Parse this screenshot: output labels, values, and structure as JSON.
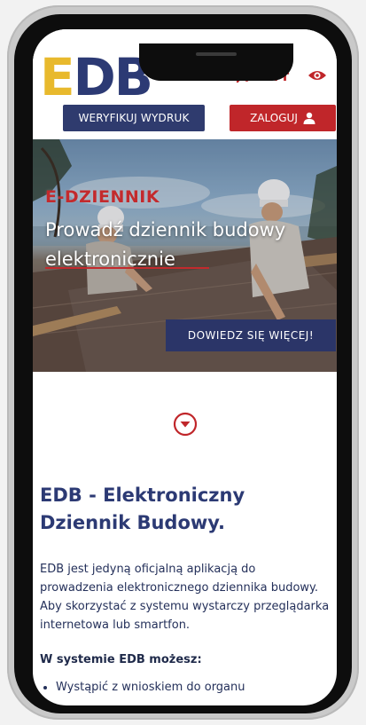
{
  "header": {
    "logo_e": "E",
    "logo_db": "DB",
    "icons": [
      "percent-icon",
      "text-size-icon",
      "eye-icon"
    ],
    "text_size_glyph": "Tт",
    "verify_label": "WERYFIKUJ WYDRUK",
    "login_label": "ZALOGUJ"
  },
  "hero": {
    "kicker": "E-DZIENNIK",
    "title": "Prowadź dziennik budowy elektronicznie",
    "cta_label": "DOWIEDZ SIĘ WIĘCEJ!"
  },
  "main": {
    "title": "EDB - Elektroniczny Dziennik Budowy.",
    "description": "EDB jest jedyną oficjalną aplikacją do prowadzenia elektronicznego dziennika budowy. Aby skorzystać z systemu wystarczy przeglądarka internetowa lub smartfon.",
    "subheading": "W systemie EDB możesz:",
    "list": [
      "Wystąpić z wnioskiem do organu"
    ]
  },
  "colors": {
    "navy": "#2f3b6e",
    "red": "#c0262a",
    "yellow": "#e8b92d"
  }
}
